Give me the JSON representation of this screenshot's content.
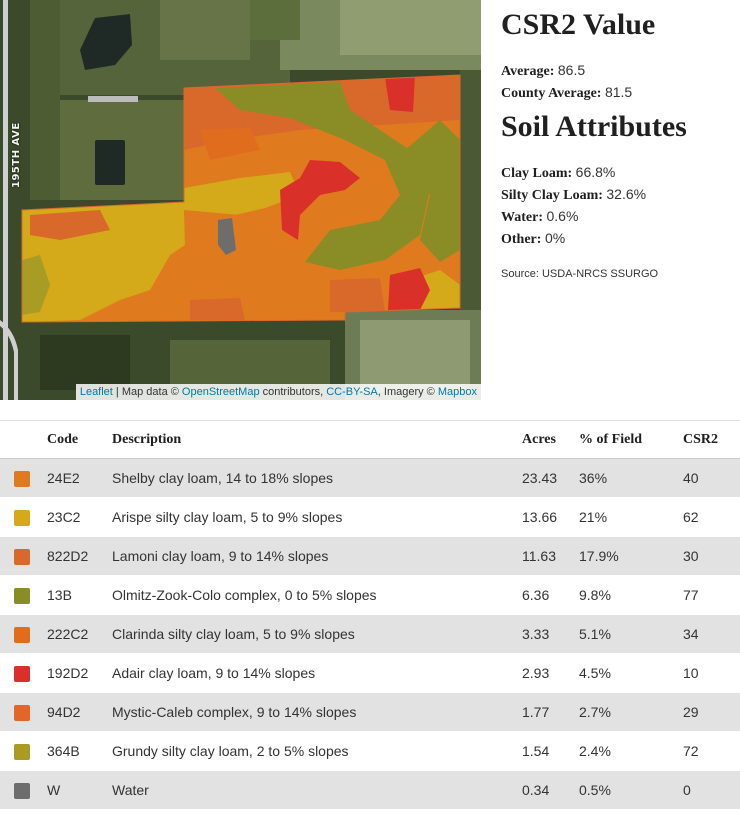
{
  "map": {
    "road_label": "195TH AVE",
    "attribution": {
      "leaflet": "Leaflet",
      "sep1": " | Map data © ",
      "osm": "OpenStreetMap",
      "contrib": " contributors, ",
      "license": "CC-BY-SA",
      "imagery": ", Imagery © ",
      "mapbox": "Mapbox"
    },
    "colors": {
      "satellite_dark": "#3f4a2c",
      "crop_light": "#8a9a6a",
      "c_24E2": "#e07a1f",
      "c_23C2": "#d4aa1a",
      "c_822D2": "#d9692a",
      "c_13B": "#8a8d26",
      "c_222C2": "#e06d1e",
      "c_192D2": "#d9302a",
      "c_94D2": "#e0662a",
      "c_364B": "#a89c24",
      "c_W": "#6d6d6d"
    }
  },
  "summary": {
    "csr_title": "CSR2 Value",
    "average_label": "Average:",
    "average_value": "86.5",
    "county_label": "County Average:",
    "county_value": "81.5",
    "soil_title": "Soil Attributes",
    "attributes": [
      {
        "label": "Clay Loam:",
        "value": "66.8%"
      },
      {
        "label": "Silty Clay Loam:",
        "value": "32.6%"
      },
      {
        "label": "Water:",
        "value": "0.6%"
      },
      {
        "label": "Other:",
        "value": "0%"
      }
    ],
    "source": "Source: USDA-NRCS SSURGO"
  },
  "table": {
    "headers": {
      "code": "Code",
      "description": "Description",
      "acres": "Acres",
      "pct": "% of Field",
      "csr2": "CSR2"
    },
    "rows": [
      {
        "color": "#e07a1f",
        "code": "24E2",
        "description": "Shelby clay loam, 14 to 18% slopes",
        "acres": "23.43",
        "pct": "36%",
        "csr2": "40"
      },
      {
        "color": "#d4aa1a",
        "code": "23C2",
        "description": "Arispe silty clay loam, 5 to 9% slopes",
        "acres": "13.66",
        "pct": "21%",
        "csr2": "62"
      },
      {
        "color": "#d9692a",
        "code": "822D2",
        "description": "Lamoni clay loam, 9 to 14% slopes",
        "acres": "11.63",
        "pct": "17.9%",
        "csr2": "30"
      },
      {
        "color": "#8a8d26",
        "code": "13B",
        "description": "Olmitz-Zook-Colo complex, 0 to 5% slopes",
        "acres": "6.36",
        "pct": "9.8%",
        "csr2": "77"
      },
      {
        "color": "#e06d1e",
        "code": "222C2",
        "description": "Clarinda silty clay loam, 5 to 9% slopes",
        "acres": "3.33",
        "pct": "5.1%",
        "csr2": "34"
      },
      {
        "color": "#d9302a",
        "code": "192D2",
        "description": "Adair clay loam, 9 to 14% slopes",
        "acres": "2.93",
        "pct": "4.5%",
        "csr2": "10"
      },
      {
        "color": "#e0662a",
        "code": "94D2",
        "description": "Mystic-Caleb complex, 9 to 14% slopes",
        "acres": "1.77",
        "pct": "2.7%",
        "csr2": "29"
      },
      {
        "color": "#a89c24",
        "code": "364B",
        "description": "Grundy silty clay loam, 2 to 5% slopes",
        "acres": "1.54",
        "pct": "2.4%",
        "csr2": "72"
      },
      {
        "color": "#6d6d6d",
        "code": "W",
        "description": "Water",
        "acres": "0.34",
        "pct": "0.5%",
        "csr2": "0"
      }
    ]
  }
}
